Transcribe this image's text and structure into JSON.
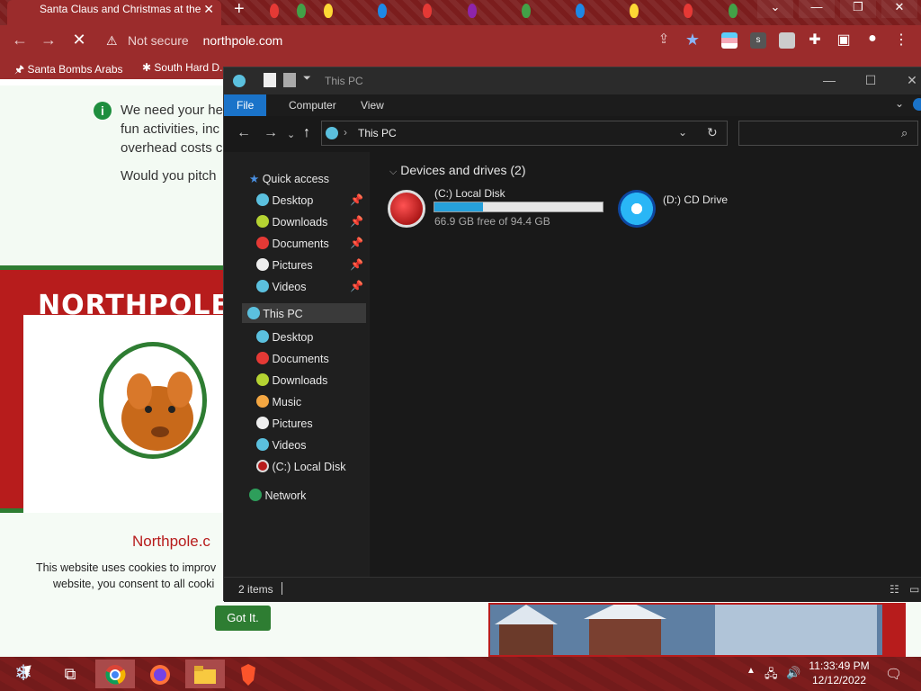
{
  "browser": {
    "tab_title": "Santa Claus and Christmas at the",
    "tab_close": "✕",
    "new_tab": "+",
    "not_secure": "Not secure",
    "url": "northpole.com",
    "bookmarks": [
      "Santa Bombs Arabs",
      "South Hard D..."
    ]
  },
  "webpage": {
    "para_lines": [
      "We need your he",
      "fun activities, inc",
      "overhead costs c"
    ],
    "para2": "Would you pitch",
    "frame_title": "NORTHPOLE",
    "site_name": "Northpole.c",
    "cookie_lines": [
      "This website uses cookies to improv",
      "website, you consent to all cooki"
    ],
    "got_it": "Got It."
  },
  "explorer": {
    "title": "This PC",
    "ribbon_tabs": [
      "File",
      "Computer",
      "View"
    ],
    "address": "This PC",
    "nav": {
      "quick_access": "Quick access",
      "qa_items": [
        "Desktop",
        "Downloads",
        "Documents",
        "Pictures",
        "Videos"
      ],
      "this_pc": "This PC",
      "pc_items": [
        "Desktop",
        "Documents",
        "Downloads",
        "Music",
        "Pictures",
        "Videos",
        "(C:) Local Disk"
      ],
      "network": "Network"
    },
    "section_title": "Devices and drives (2)",
    "drives": [
      {
        "label": "(C:) Local Disk",
        "free": "66.9 GB free of 94.4 GB",
        "used_fraction": 0.29
      },
      {
        "label": "(D:) CD Drive"
      }
    ],
    "status": "2 items"
  },
  "taskbar": {
    "time": "11:33:49 PM",
    "date": "12/12/2022"
  },
  "colors": {
    "chrome_red": "#9b2c2c",
    "explorer_dark": "#202020",
    "accent_blue": "#1a73c9",
    "drive_bar": "#26a0da"
  }
}
